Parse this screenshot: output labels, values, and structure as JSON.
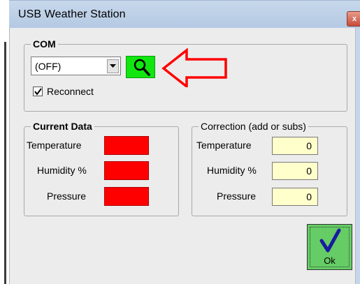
{
  "window": {
    "title": "USB Weather Station",
    "close_glyph": "x"
  },
  "com": {
    "group_title": "COM",
    "port_value": "(OFF)",
    "search_icon": "magnifier-icon",
    "reconnect_label": "Reconnect",
    "reconnect_checked": true
  },
  "current_data": {
    "group_title": "Current Data",
    "temperature_label": "Temperature",
    "humidity_label": "Humidity %",
    "pressure_label": "Pressure"
  },
  "correction": {
    "group_title": "Correction (add or subs)",
    "temperature_label": "Temperature",
    "humidity_label": "Humidity %",
    "pressure_label": "Pressure",
    "temperature_value": "0",
    "humidity_value": "0",
    "pressure_value": "0"
  },
  "ok_button": {
    "label": "Ok",
    "icon": "checkmark-icon"
  },
  "colors": {
    "live_value_fill": "#ff0000",
    "correction_fill": "#ffffcc",
    "search_button": "#11e611",
    "ok_button": "#66cc66",
    "annotation_arrow": "#ff0000"
  }
}
